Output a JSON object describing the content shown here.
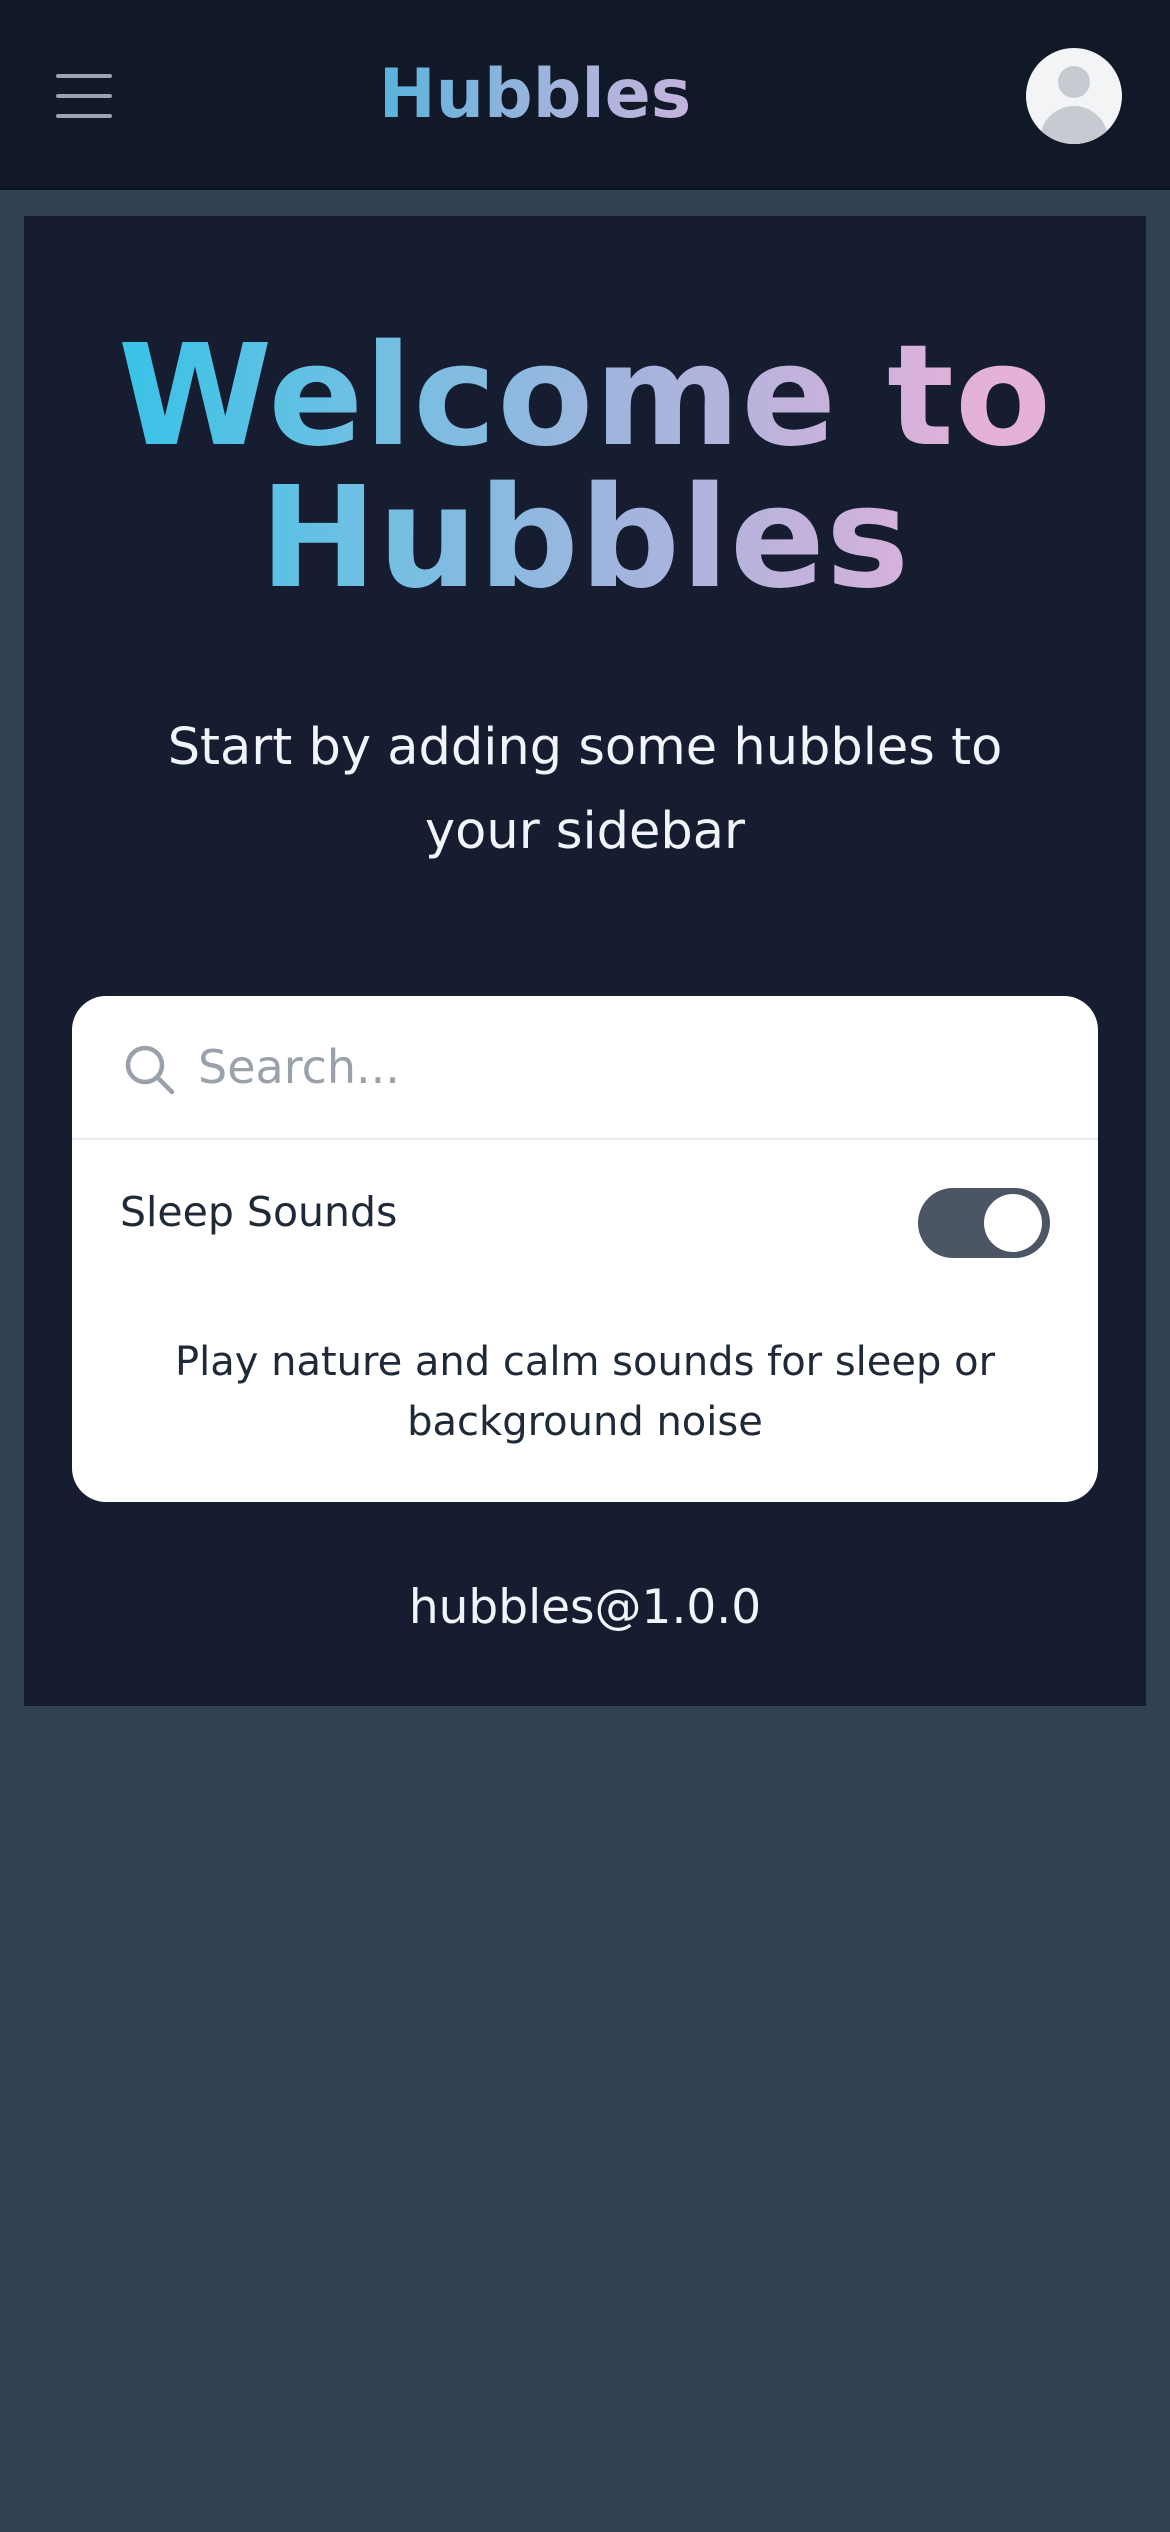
{
  "header": {
    "menu_icon": "hamburger-menu-icon",
    "title": "Hubbles",
    "avatar_icon": "user-avatar-icon"
  },
  "welcome": {
    "heading": "Welcome to Hubbles",
    "subtitle": "Start by adding some hubbles to your sidebar"
  },
  "card": {
    "search": {
      "icon": "search-icon",
      "placeholder": "Search..."
    },
    "item": {
      "label": "Sleep Sounds",
      "enabled": true,
      "description": "Play nature and calm sounds for sleep or background noise"
    }
  },
  "footer": {
    "version": "hubbles@1.0.0"
  },
  "colors": {
    "topbar_bg": "#111827",
    "page_bg": "#334155",
    "panel_bg": "#161d30",
    "card_bg": "#ffffff",
    "toggle_on": "#4b5563",
    "gradient_start": "#22c4e8",
    "gradient_end": "#e3b1da"
  }
}
